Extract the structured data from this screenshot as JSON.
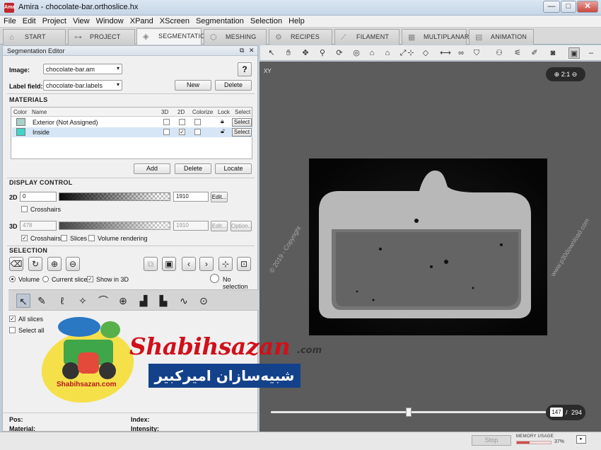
{
  "window": {
    "app_logo_text": "Ama",
    "title": "Amira - chocolate-bar.orthoslice.hx",
    "minimize_glyph": "—",
    "maximize_glyph": "□",
    "close_glyph": "✕"
  },
  "menu": [
    "File",
    "Edit",
    "Project",
    "View",
    "Window",
    "XPand",
    "XScreen",
    "Segmentation",
    "Selection",
    "Help"
  ],
  "tabs": [
    {
      "label": "START",
      "icon": "home-icon",
      "glyph": "⌂"
    },
    {
      "label": "PROJECT",
      "icon": "graph-icon",
      "glyph": "⊶"
    },
    {
      "label": "SEGMENTATION",
      "icon": "layers-icon",
      "glyph": "◈"
    },
    {
      "label": "MESHING",
      "icon": "mesh-icon",
      "glyph": "⬡"
    },
    {
      "label": "RECIPES",
      "icon": "gears-icon",
      "glyph": "⚙"
    },
    {
      "label": "FILAMENT",
      "icon": "filament-icon",
      "glyph": "⟋"
    },
    {
      "label": "MULTIPLANAR",
      "icon": "grid-icon",
      "glyph": "▦"
    },
    {
      "label": "ANIMATION",
      "icon": "film-icon",
      "glyph": "▤"
    }
  ],
  "active_tab": "SEGMENTATION",
  "editor": {
    "title": "Segmentation Editor",
    "float_glyph": "⧉",
    "close_glyph": "✕",
    "image_label": "Image:",
    "image_value": "chocolate-bar.am",
    "help_glyph": "?",
    "labelfield_label": "Label field:",
    "labelfield_value": "chocolate-bar.labels",
    "new_label": "New",
    "delete_label": "Delete",
    "materials_heading": "MATERIALS",
    "columns": [
      "Color",
      "Name",
      "3D",
      "2D",
      "Colorize",
      "Lock",
      "Select"
    ],
    "materials": [
      {
        "name": "Exterior (Not Assigned)",
        "color": "#a9d0cc",
        "d3": false,
        "d2": false,
        "colorize": false,
        "select": "Select"
      },
      {
        "name": "Inside",
        "color": "#3fd6c8",
        "d3": false,
        "d2": true,
        "colorize": false,
        "select": "Select"
      }
    ],
    "add_label": "Add",
    "mat_delete_label": "Delete",
    "locate_label": "Locate",
    "display_heading": "DISPLAY CONTROL",
    "d2_label": "2D",
    "d2_min": "0",
    "d2_max": "1910",
    "edit_label": "Edit...",
    "crosshairs_label": "Crosshairs",
    "d3_label": "3D",
    "d3_min": "478",
    "d3_max": "1910",
    "d3_edit_label": "Edit...",
    "options_label": "Option...",
    "crosshairs3d_label": "Crosshairs",
    "slices_label": "Slices",
    "volume_rendering_label": "Volume rendering",
    "selection_heading": "SELECTION",
    "volume_label": "Volume",
    "current_slice_label": "Current slice",
    "show_in_3d_label": "Show in 3D",
    "no_selection_label": "No selection",
    "all_slices_label": "All slices",
    "select_all_label": "Select all"
  },
  "viewer": {
    "view_label": "XY",
    "zoom_text": "2:1",
    "current_slice": "147",
    "slice_sep": "/",
    "total_slices": "294",
    "slider_fraction": 0.5
  },
  "info": {
    "pos_label": "Pos:",
    "index_label": "Index:",
    "material_label": "Material:",
    "intensity_label": "Intensity:"
  },
  "status": {
    "stop_label": "Stop",
    "memory_label": "MEMORY USAGE",
    "memory_pct": "37%",
    "memory_fraction": 0.37
  },
  "watermark": {
    "brand": "Shabihsazan",
    "brand_domain": ".com",
    "persian": "شبیه‌سازان امیرکبیر",
    "site": "www.p30download.com",
    "copyright": "© 2019 - Copyright",
    "logo_caption": "Shabihsazan.com"
  }
}
